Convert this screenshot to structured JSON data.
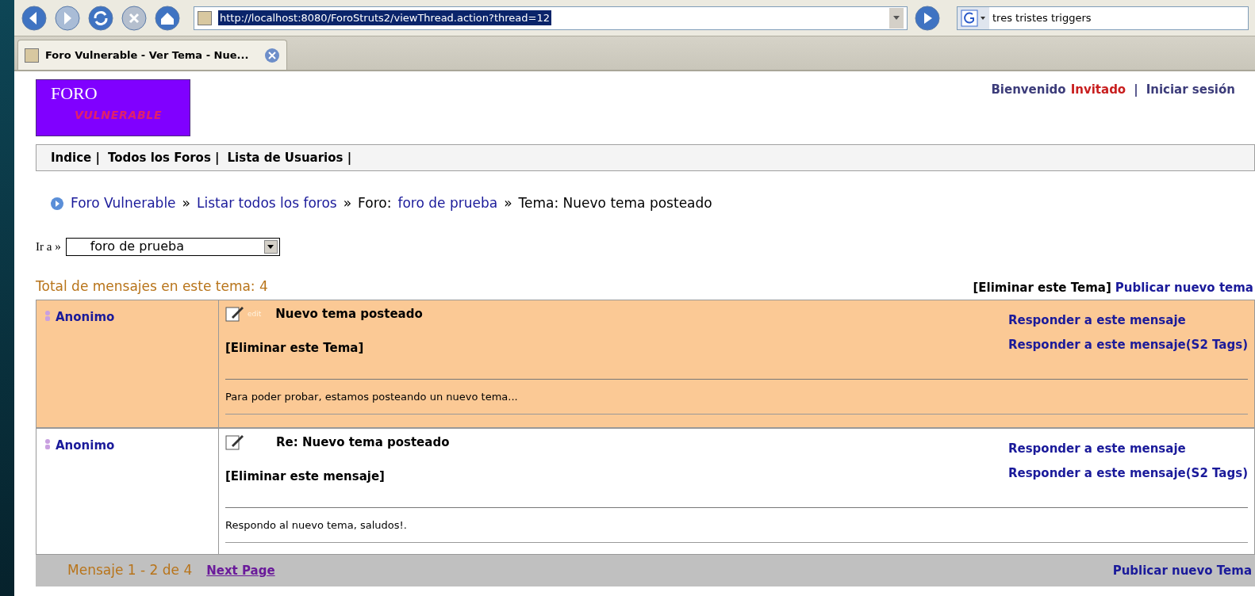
{
  "browser": {
    "url": "http://localhost:8080/ForoStruts2/viewThread.action?thread=12",
    "search": "tres tristes triggers",
    "tabs": [
      {
        "label": "Foro Vulnerable - Ver Tema - Nue...",
        "selected": true
      }
    ]
  },
  "logo": {
    "line1": "FORO",
    "line2": "VULNERABLE"
  },
  "user_bar": {
    "greeting": "Bienvenido",
    "user": "Invitado",
    "separator": "|",
    "login": "Iniciar sesión"
  },
  "nav": [
    "Indice |",
    "Todos los Foros |",
    "Lista de Usuarios |"
  ],
  "breadcrumb": [
    {
      "text": "Foro Vulnerable",
      "kind": "link"
    },
    {
      "text": "»",
      "kind": "sep"
    },
    {
      "text": "Listar todos los foros",
      "kind": "link"
    },
    {
      "text": "»",
      "kind": "sep"
    },
    {
      "text": "Foro:",
      "kind": "plain"
    },
    {
      "text": "foro de prueba",
      "kind": "link"
    },
    {
      "text": "»",
      "kind": "sep"
    },
    {
      "text": "Tema: Nuevo tema posteado",
      "kind": "plain"
    }
  ],
  "jump": {
    "label": "Ir a »",
    "value": "foro de prueba"
  },
  "total": "Total de mensajes en este tema: 4",
  "actions": [
    {
      "text": "[Eliminar este Tema]",
      "kind": "plain"
    },
    {
      "text": "Publicar nuevo tema",
      "kind": "link"
    }
  ],
  "posts": [
    {
      "author": "Anonimo",
      "highlighted": true,
      "icon_alt": "edit",
      "title": "Nuevo tema posteado",
      "delete": "[Eliminar este Tema]",
      "body": "Para poder probar, estamos posteando un nuevo tema...",
      "replies": [
        "Responder a este mensaje",
        "Responder a este mensaje(S2 Tags)"
      ]
    },
    {
      "author": "Anonimo",
      "highlighted": false,
      "title": "Re: Nuevo tema posteado",
      "delete": "[Eliminar este mensaje]",
      "body": "Respondo al nuevo tema, saludos!.",
      "replies": [
        "Responder a este mensaje",
        "Responder a este mensaje(S2 Tags)"
      ]
    }
  ],
  "footer": {
    "range": "Mensaje 1 - 2 de 4",
    "next": "Next Page",
    "publish": "Publicar nuevo Tema"
  }
}
